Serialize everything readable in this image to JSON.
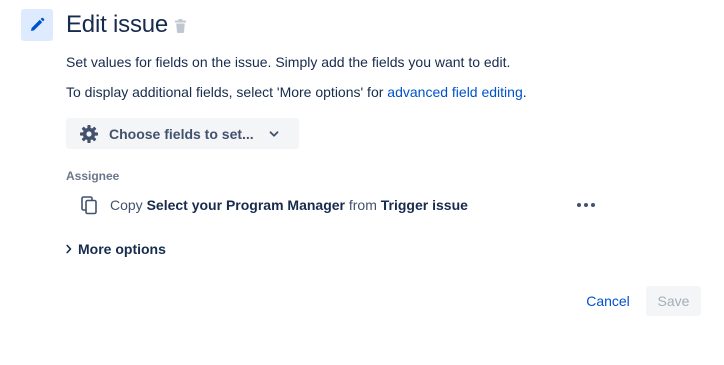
{
  "header": {
    "title": "Edit issue",
    "action_icon": "pencil-icon",
    "delete_icon": "trash-icon"
  },
  "description": {
    "line1": "Set values for fields on the issue. Simply add the fields you want to edit.",
    "line2_prefix": "To display additional fields, select 'More options' for ",
    "line2_link": "advanced field editing",
    "line2_suffix": "."
  },
  "choose_fields": {
    "label": "Choose fields to set...",
    "icon": "gear-icon",
    "chevron_icon": "chevron-down-icon"
  },
  "fields": {
    "assignee_label": "Assignee",
    "assignee_copy_word": "Copy",
    "assignee_source_field": "Select your Program Manager",
    "assignee_from_word": "from",
    "assignee_source_issue": "Trigger issue",
    "copy_icon": "copy-icon",
    "more_icon": "more-icon"
  },
  "more_options": {
    "label": "More options",
    "icon": "chevron-right-icon"
  },
  "footer": {
    "cancel_label": "Cancel",
    "save_label": "Save"
  },
  "colors": {
    "accent": "#0052cc",
    "icon_bg": "#deebff",
    "text": "#172b4d",
    "subtle": "#6b778c",
    "button_bg": "#f4f5f7",
    "disabled_text": "#a5adba"
  }
}
